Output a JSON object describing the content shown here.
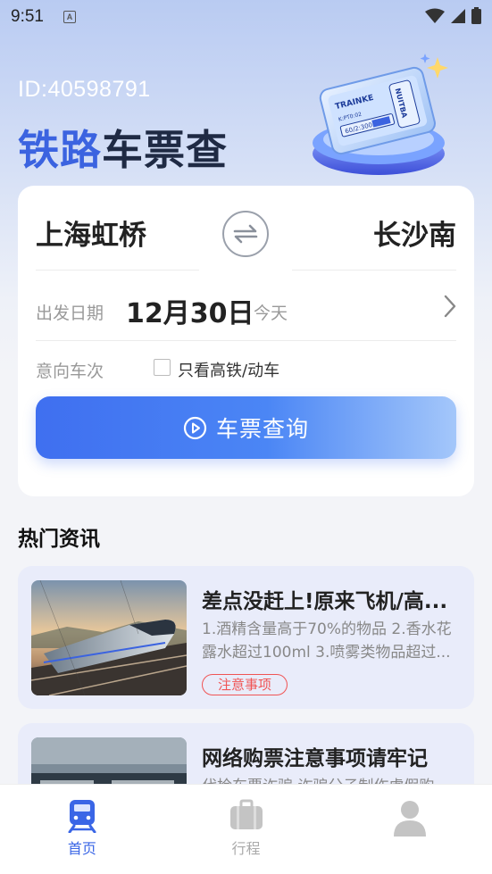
{
  "status_bar": {
    "time": "9:51",
    "notification_letter": "A"
  },
  "header": {
    "user_id": "ID:40598791",
    "title_part1": "铁路",
    "title_part2": "车票查",
    "illustration_ticket_text": "TRAINKE",
    "illustration_ticket_badge": "NUITBA",
    "illustration_ticket_code": "60/2:300",
    "illustration_ticket_line": "K:PT0:02"
  },
  "search_card": {
    "from_station": "上海虹桥",
    "to_station": "长沙南",
    "date_label": "出发日期",
    "date_value": "12月30日",
    "date_sub": "今天",
    "train_label": "意向车次",
    "hsr_only_label": "只看高铁/动车",
    "search_button": "车票查询"
  },
  "news": {
    "section_title": "热门资讯",
    "items": [
      {
        "title": "差点没赶上!原来飞机/高...",
        "summary": "1.酒精含量高于70%的物品 2.香水花露水超过100ml 3.喷雾类物品超过...",
        "tag": "注意事项"
      },
      {
        "title": "网络购票注意事项请牢记",
        "summary": "代检车票诈骗 诈骗分子制作虚假购"
      }
    ]
  },
  "bottom_nav": {
    "items": [
      {
        "label": "首页",
        "icon": "train-icon"
      },
      {
        "label": "行程",
        "icon": "suitcase-icon"
      },
      {
        "label": "",
        "icon": "person-icon"
      }
    ]
  },
  "colors": {
    "accent": "#3a66e6",
    "tag": "#f05454",
    "news_card_bg": "#e9ecfa"
  }
}
